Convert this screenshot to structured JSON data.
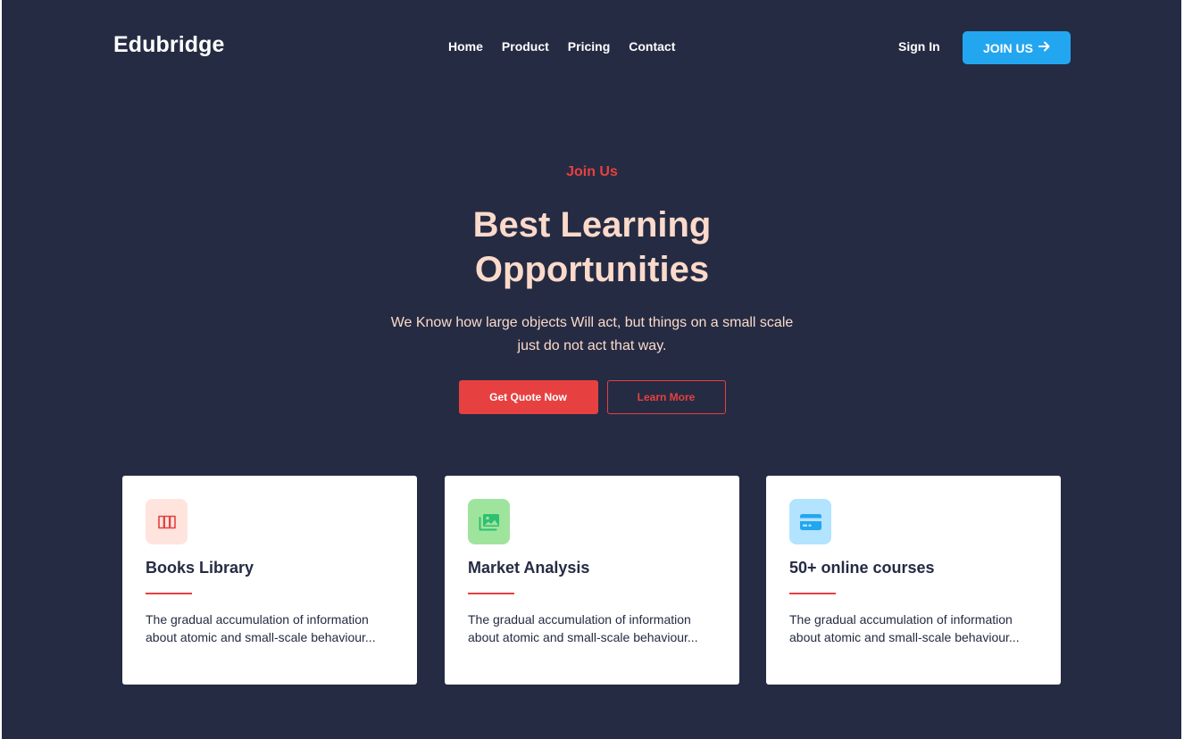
{
  "header": {
    "brand": "Edubridge",
    "nav": [
      "Home",
      "Product",
      "Pricing",
      "Contact"
    ],
    "sign_in": "Sign In",
    "join_button": "JOIN US",
    "join_icon": "arrow-right-icon"
  },
  "hero": {
    "eyebrow": "Join Us",
    "headline_line1": "Best Learning",
    "headline_line2": "Opportunities",
    "subtitle": "We Know how large objects Will act, but things on a small scale just do not act that way.",
    "primary_button": "Get Quote Now",
    "secondary_button": "Learn More"
  },
  "features": [
    {
      "icon": "book-icon",
      "icon_color": "#e74040",
      "icon_bg": "#ffe4de",
      "title": "Books Library",
      "text": "The gradual accumulation of information about atomic and small-scale behaviour..."
    },
    {
      "icon": "gallery-icon",
      "icon_color": "#2dc071",
      "icon_bg": "#9fe49d",
      "title": "Market Analysis",
      "text": "The gradual accumulation of information about atomic and small-scale behaviour..."
    },
    {
      "icon": "credit-card-icon",
      "icon_color": "#23a6f0",
      "icon_bg": "#b2e3ff",
      "title": "50+ online courses",
      "text": "The gradual accumulation of information about atomic and small-scale behaviour..."
    }
  ],
  "colors": {
    "background": "#252b42",
    "accent_red": "#e74040",
    "accent_blue": "#23a6f0",
    "hero_text": "#fbdacb"
  }
}
